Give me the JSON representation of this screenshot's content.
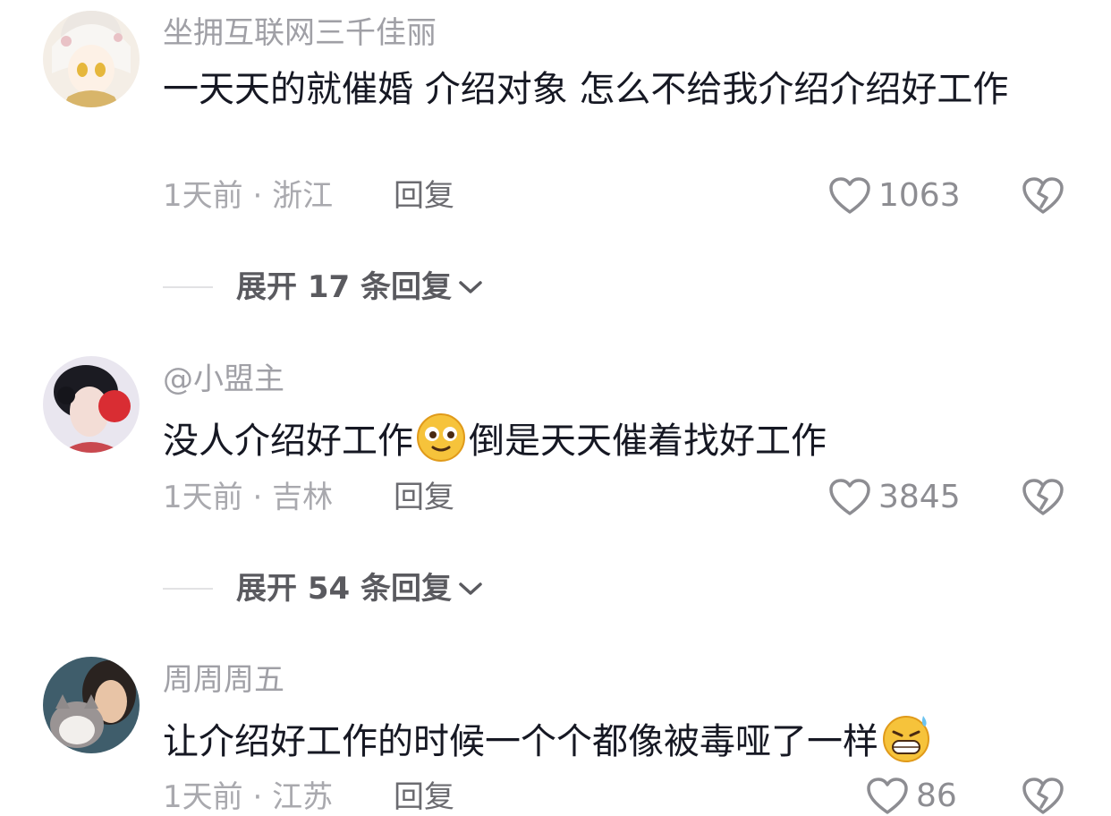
{
  "comments": [
    {
      "username": "坐拥互联网三千佳丽",
      "text": "一天天的就催婚 介绍对象 怎么不给我介绍介绍好工作",
      "time": "1天前",
      "location": "浙江",
      "reply_label": "回复",
      "likes": "1063",
      "expand_label": "展开 17 条回复",
      "avatar": "anime-girl-avatar"
    },
    {
      "username": "@小盟主",
      "text_before": "没人介绍好工作",
      "emoji": "smile-emoji",
      "text_after": "倒是天天催着找好工作",
      "time": "1天前",
      "location": "吉林",
      "reply_label": "回复",
      "likes": "3845",
      "expand_label": "展开 54 条回复",
      "avatar": "woman-with-red-fan-avatar"
    },
    {
      "username": "周周周五",
      "text": "让介绍好工作的时候一个个都像被毒哑了一样",
      "emoji": "grin-sweat-emoji",
      "time": "1天前",
      "location": "江苏",
      "reply_label": "回复",
      "likes": "86",
      "avatar": "girl-with-cat-avatar"
    }
  ],
  "separator": "·",
  "colors": {
    "text": "#161823",
    "muted": "#a9a9ae",
    "reply": "#6b6b70",
    "like_icon": "#8d8d92"
  }
}
